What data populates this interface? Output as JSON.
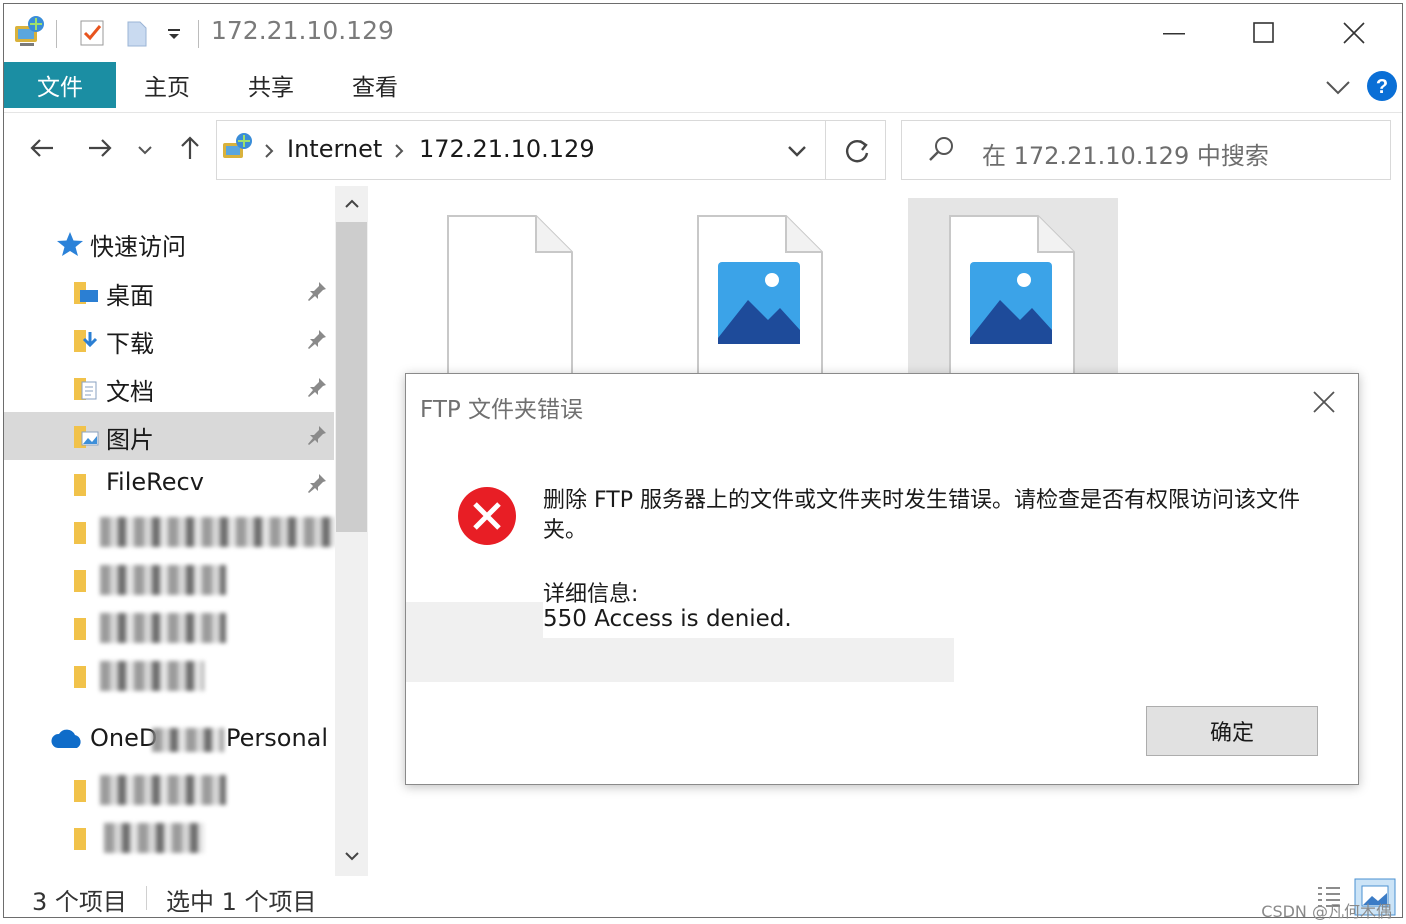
{
  "window": {
    "title": "172.21.10.129"
  },
  "ribbon": {
    "tabs": [
      "文件",
      "主页",
      "共享",
      "查看"
    ]
  },
  "address": {
    "crumbs": [
      "Internet",
      "172.21.10.129"
    ]
  },
  "search": {
    "placeholder": "在 172.21.10.129 中搜索"
  },
  "nav": {
    "quick_access": "快速访问",
    "items": [
      {
        "label": "桌面",
        "pinned": true
      },
      {
        "label": "下载",
        "pinned": true
      },
      {
        "label": "文档",
        "pinned": true
      },
      {
        "label": "图片",
        "pinned": true,
        "selected": true
      },
      {
        "label": "FileRecv",
        "pinned": true
      }
    ],
    "onedrive_prefix": "OneD",
    "onedrive_suffix": "Personal"
  },
  "status": {
    "item_count": "3 个项目",
    "selected_count": "选中 1 个项目"
  },
  "dialog": {
    "title": "FTP 文件夹错误",
    "message": "删除 FTP 服务器上的文件或文件夹时发生错误。请检查是否有权限访问该文件夹。",
    "detail_heading": "详细信息:",
    "detail_value": "550 Access is denied.",
    "ok_label": "确定"
  },
  "watermark": "CSDN @凡何木偶",
  "colors": {
    "file_tab": "#1b8ea3",
    "error_red": "#e81e25",
    "selection": "#d9d9d9",
    "help_blue": "#0a6fd6"
  }
}
